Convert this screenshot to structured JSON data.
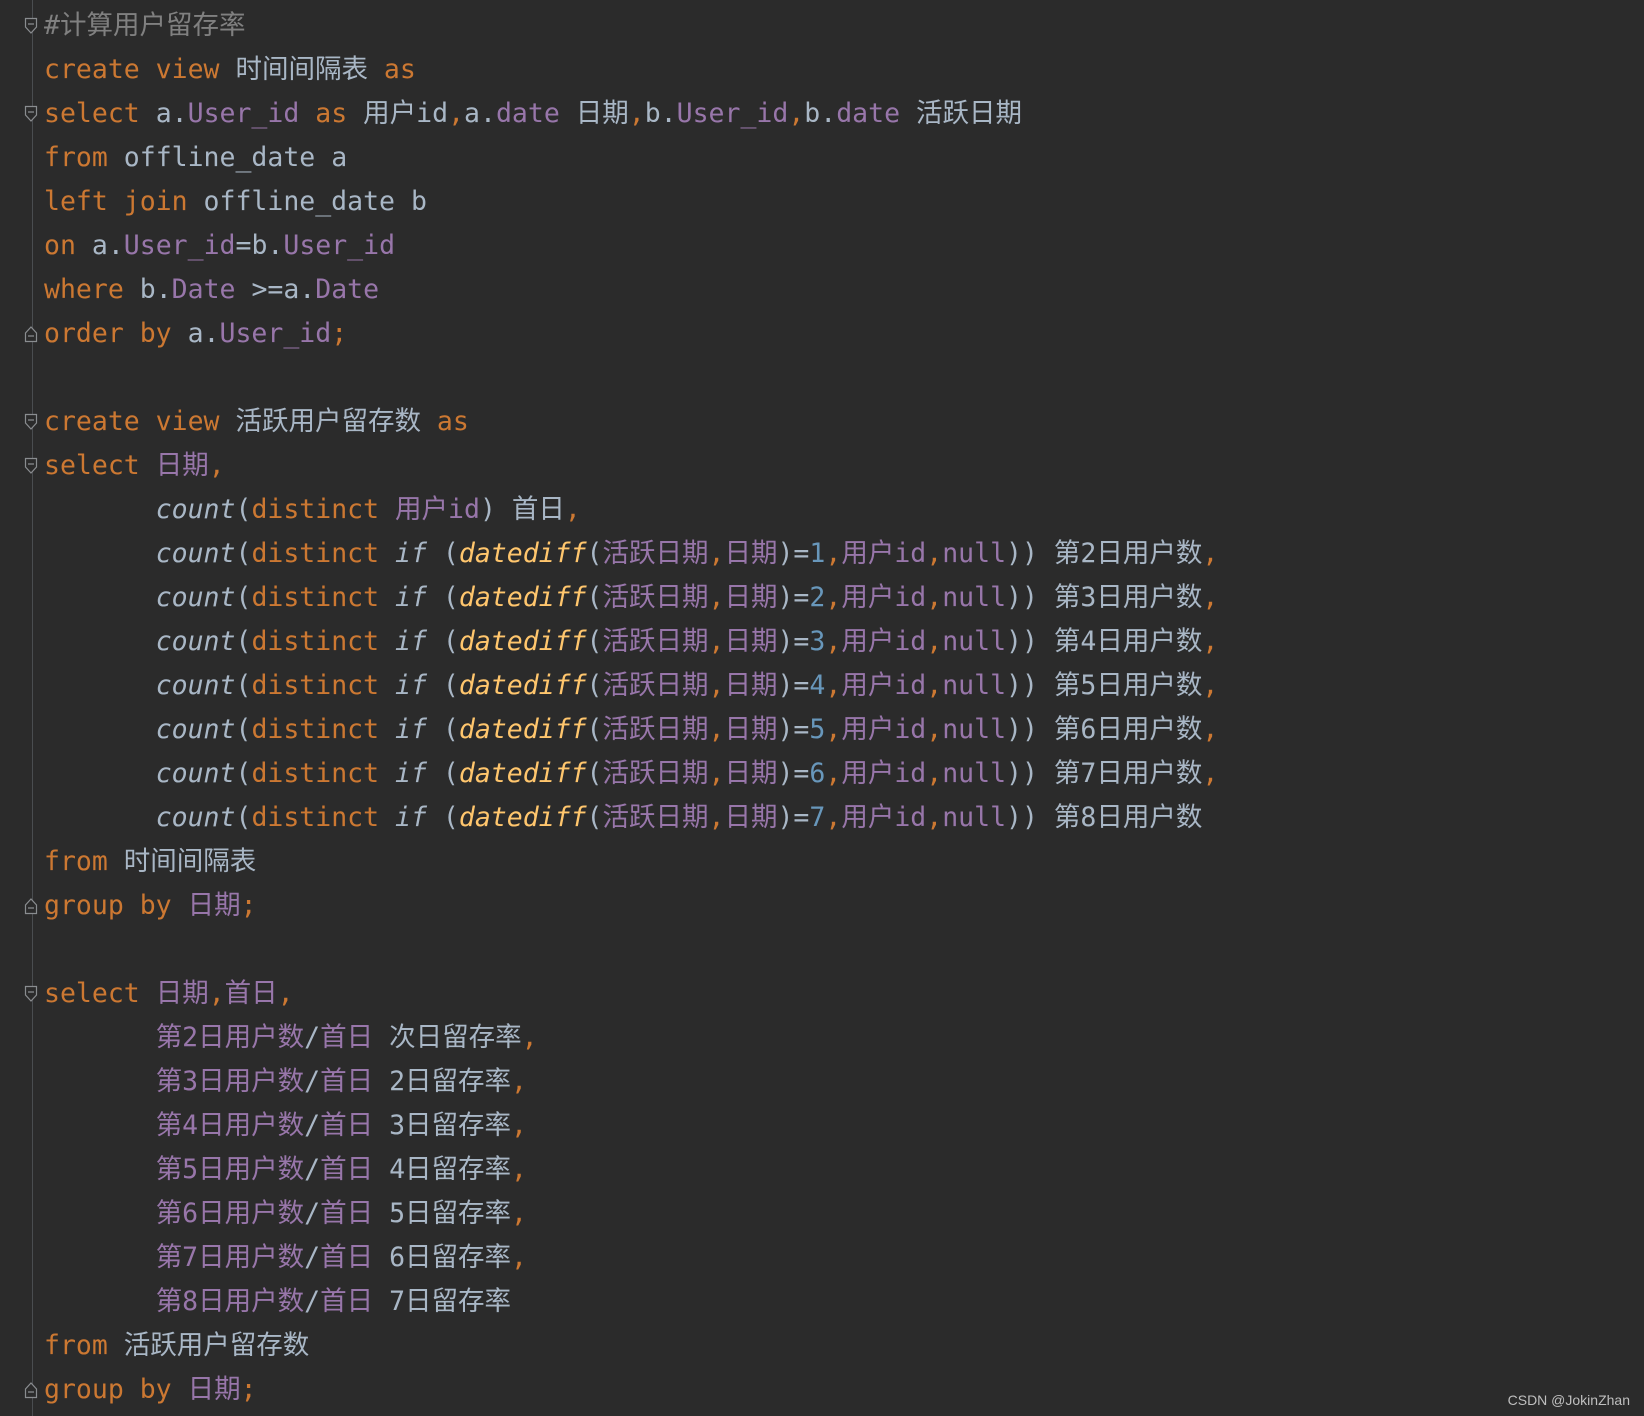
{
  "editor": {
    "lines": [
      [
        {
          "t": "#计算用户留存率",
          "c": "cm"
        }
      ],
      [
        {
          "t": "create view",
          "c": "kw"
        },
        {
          "t": " 时间间隔表 "
        },
        {
          "t": "as",
          "c": "kw"
        }
      ],
      [
        {
          "t": "select",
          "c": "kw"
        },
        {
          "t": " a."
        },
        {
          "t": "User_id",
          "c": "fld"
        },
        {
          "t": " "
        },
        {
          "t": "as",
          "c": "kw"
        },
        {
          "t": " 用户id"
        },
        {
          "t": ",",
          "c": "kw"
        },
        {
          "t": "a."
        },
        {
          "t": "date",
          "c": "fld"
        },
        {
          "t": " 日期"
        },
        {
          "t": ",",
          "c": "kw"
        },
        {
          "t": "b."
        },
        {
          "t": "User_id",
          "c": "fld"
        },
        {
          "t": ",",
          "c": "kw"
        },
        {
          "t": "b."
        },
        {
          "t": "date",
          "c": "fld"
        },
        {
          "t": " 活跃日期"
        }
      ],
      [
        {
          "t": "from",
          "c": "kw"
        },
        {
          "t": " offline_date a"
        }
      ],
      [
        {
          "t": "left join",
          "c": "kw"
        },
        {
          "t": " offline_date b"
        }
      ],
      [
        {
          "t": "on",
          "c": "kw"
        },
        {
          "t": " a."
        },
        {
          "t": "User_id",
          "c": "fld"
        },
        {
          "t": "=b."
        },
        {
          "t": "User_id",
          "c": "fld"
        }
      ],
      [
        {
          "t": "where",
          "c": "kw"
        },
        {
          "t": " b."
        },
        {
          "t": "Date",
          "c": "fld"
        },
        {
          "t": " >=a."
        },
        {
          "t": "Date",
          "c": "fld"
        }
      ],
      [
        {
          "t": "order by",
          "c": "kw"
        },
        {
          "t": " a."
        },
        {
          "t": "User_id",
          "c": "fld"
        },
        {
          "t": ";",
          "c": "kw"
        }
      ],
      [],
      [
        {
          "t": "create view",
          "c": "kw"
        },
        {
          "t": " 活跃用户留存数 "
        },
        {
          "t": "as",
          "c": "kw"
        }
      ],
      [
        {
          "t": "select",
          "c": "kw"
        },
        {
          "t": " "
        },
        {
          "t": "日期",
          "c": "fld"
        },
        {
          "t": ",",
          "c": "kw"
        }
      ],
      [
        {
          "t": "       "
        },
        {
          "t": "count",
          "c": "it"
        },
        {
          "t": "("
        },
        {
          "t": "distinct",
          "c": "kw"
        },
        {
          "t": " "
        },
        {
          "t": "用户id",
          "c": "fld"
        },
        {
          "t": ") 首日"
        },
        {
          "t": ",",
          "c": "kw"
        }
      ],
      [
        {
          "t": "       "
        },
        {
          "t": "count",
          "c": "it"
        },
        {
          "t": "("
        },
        {
          "t": "distinct",
          "c": "kw"
        },
        {
          "t": " "
        },
        {
          "t": "if",
          "c": "it"
        },
        {
          "t": " ("
        },
        {
          "t": "datediff",
          "c": "fn"
        },
        {
          "t": "("
        },
        {
          "t": "活跃日期",
          "c": "fld"
        },
        {
          "t": ",",
          "c": "kw"
        },
        {
          "t": "日期",
          "c": "fld"
        },
        {
          "t": ")="
        },
        {
          "t": "1",
          "c": "num"
        },
        {
          "t": ",",
          "c": "kw"
        },
        {
          "t": "用户id",
          "c": "fld"
        },
        {
          "t": ",",
          "c": "kw"
        },
        {
          "t": "null",
          "c": "fld"
        },
        {
          "t": ")) 第2日用户数"
        },
        {
          "t": ",",
          "c": "kw"
        }
      ],
      [
        {
          "t": "       "
        },
        {
          "t": "count",
          "c": "it"
        },
        {
          "t": "("
        },
        {
          "t": "distinct",
          "c": "kw"
        },
        {
          "t": " "
        },
        {
          "t": "if",
          "c": "it"
        },
        {
          "t": " ("
        },
        {
          "t": "datediff",
          "c": "fn"
        },
        {
          "t": "("
        },
        {
          "t": "活跃日期",
          "c": "fld"
        },
        {
          "t": ",",
          "c": "kw"
        },
        {
          "t": "日期",
          "c": "fld"
        },
        {
          "t": ")="
        },
        {
          "t": "2",
          "c": "num"
        },
        {
          "t": ",",
          "c": "kw"
        },
        {
          "t": "用户id",
          "c": "fld"
        },
        {
          "t": ",",
          "c": "kw"
        },
        {
          "t": "null",
          "c": "fld"
        },
        {
          "t": ")) 第3日用户数"
        },
        {
          "t": ",",
          "c": "kw"
        }
      ],
      [
        {
          "t": "       "
        },
        {
          "t": "count",
          "c": "it"
        },
        {
          "t": "("
        },
        {
          "t": "distinct",
          "c": "kw"
        },
        {
          "t": " "
        },
        {
          "t": "if",
          "c": "it"
        },
        {
          "t": " ("
        },
        {
          "t": "datediff",
          "c": "fn"
        },
        {
          "t": "("
        },
        {
          "t": "活跃日期",
          "c": "fld"
        },
        {
          "t": ",",
          "c": "kw"
        },
        {
          "t": "日期",
          "c": "fld"
        },
        {
          "t": ")="
        },
        {
          "t": "3",
          "c": "num"
        },
        {
          "t": ",",
          "c": "kw"
        },
        {
          "t": "用户id",
          "c": "fld"
        },
        {
          "t": ",",
          "c": "kw"
        },
        {
          "t": "null",
          "c": "fld"
        },
        {
          "t": ")) 第4日用户数"
        },
        {
          "t": ",",
          "c": "kw"
        }
      ],
      [
        {
          "t": "       "
        },
        {
          "t": "count",
          "c": "it"
        },
        {
          "t": "("
        },
        {
          "t": "distinct",
          "c": "kw"
        },
        {
          "t": " "
        },
        {
          "t": "if",
          "c": "it"
        },
        {
          "t": " ("
        },
        {
          "t": "datediff",
          "c": "fn"
        },
        {
          "t": "("
        },
        {
          "t": "活跃日期",
          "c": "fld"
        },
        {
          "t": ",",
          "c": "kw"
        },
        {
          "t": "日期",
          "c": "fld"
        },
        {
          "t": ")="
        },
        {
          "t": "4",
          "c": "num"
        },
        {
          "t": ",",
          "c": "kw"
        },
        {
          "t": "用户id",
          "c": "fld"
        },
        {
          "t": ",",
          "c": "kw"
        },
        {
          "t": "null",
          "c": "fld"
        },
        {
          "t": ")) 第5日用户数"
        },
        {
          "t": ",",
          "c": "kw"
        }
      ],
      [
        {
          "t": "       "
        },
        {
          "t": "count",
          "c": "it"
        },
        {
          "t": "("
        },
        {
          "t": "distinct",
          "c": "kw"
        },
        {
          "t": " "
        },
        {
          "t": "if",
          "c": "it"
        },
        {
          "t": " ("
        },
        {
          "t": "datediff",
          "c": "fn"
        },
        {
          "t": "("
        },
        {
          "t": "活跃日期",
          "c": "fld"
        },
        {
          "t": ",",
          "c": "kw"
        },
        {
          "t": "日期",
          "c": "fld"
        },
        {
          "t": ")="
        },
        {
          "t": "5",
          "c": "num"
        },
        {
          "t": ",",
          "c": "kw"
        },
        {
          "t": "用户id",
          "c": "fld"
        },
        {
          "t": ",",
          "c": "kw"
        },
        {
          "t": "null",
          "c": "fld"
        },
        {
          "t": ")) 第6日用户数"
        },
        {
          "t": ",",
          "c": "kw"
        }
      ],
      [
        {
          "t": "       "
        },
        {
          "t": "count",
          "c": "it"
        },
        {
          "t": "("
        },
        {
          "t": "distinct",
          "c": "kw"
        },
        {
          "t": " "
        },
        {
          "t": "if",
          "c": "it"
        },
        {
          "t": " ("
        },
        {
          "t": "datediff",
          "c": "fn"
        },
        {
          "t": "("
        },
        {
          "t": "活跃日期",
          "c": "fld"
        },
        {
          "t": ",",
          "c": "kw"
        },
        {
          "t": "日期",
          "c": "fld"
        },
        {
          "t": ")="
        },
        {
          "t": "6",
          "c": "num"
        },
        {
          "t": ",",
          "c": "kw"
        },
        {
          "t": "用户id",
          "c": "fld"
        },
        {
          "t": ",",
          "c": "kw"
        },
        {
          "t": "null",
          "c": "fld"
        },
        {
          "t": ")) 第7日用户数"
        },
        {
          "t": ",",
          "c": "kw"
        }
      ],
      [
        {
          "t": "       "
        },
        {
          "t": "count",
          "c": "it"
        },
        {
          "t": "("
        },
        {
          "t": "distinct",
          "c": "kw"
        },
        {
          "t": " "
        },
        {
          "t": "if",
          "c": "it"
        },
        {
          "t": " ("
        },
        {
          "t": "datediff",
          "c": "fn"
        },
        {
          "t": "("
        },
        {
          "t": "活跃日期",
          "c": "fld"
        },
        {
          "t": ",",
          "c": "kw"
        },
        {
          "t": "日期",
          "c": "fld"
        },
        {
          "t": ")="
        },
        {
          "t": "7",
          "c": "num"
        },
        {
          "t": ",",
          "c": "kw"
        },
        {
          "t": "用户id",
          "c": "fld"
        },
        {
          "t": ",",
          "c": "kw"
        },
        {
          "t": "null",
          "c": "fld"
        },
        {
          "t": ")) 第8日用户数"
        }
      ],
      [
        {
          "t": "from",
          "c": "kw"
        },
        {
          "t": " 时间间隔表"
        }
      ],
      [
        {
          "t": "group by",
          "c": "kw"
        },
        {
          "t": " "
        },
        {
          "t": "日期",
          "c": "fld"
        },
        {
          "t": ";",
          "c": "kw"
        }
      ],
      [],
      [
        {
          "t": "select",
          "c": "kw"
        },
        {
          "t": " "
        },
        {
          "t": "日期",
          "c": "fld"
        },
        {
          "t": ",",
          "c": "kw"
        },
        {
          "t": "首日",
          "c": "fld"
        },
        {
          "t": ",",
          "c": "kw"
        }
      ],
      [
        {
          "t": "       "
        },
        {
          "t": "第2日用户数",
          "c": "fld"
        },
        {
          "t": "/"
        },
        {
          "t": "首日",
          "c": "fld"
        },
        {
          "t": " 次日留存率"
        },
        {
          "t": ",",
          "c": "kw"
        }
      ],
      [
        {
          "t": "       "
        },
        {
          "t": "第3日用户数",
          "c": "fld"
        },
        {
          "t": "/"
        },
        {
          "t": "首日",
          "c": "fld"
        },
        {
          "t": " 2日留存率"
        },
        {
          "t": ",",
          "c": "kw"
        }
      ],
      [
        {
          "t": "       "
        },
        {
          "t": "第4日用户数",
          "c": "fld"
        },
        {
          "t": "/"
        },
        {
          "t": "首日",
          "c": "fld"
        },
        {
          "t": " 3日留存率"
        },
        {
          "t": ",",
          "c": "kw"
        }
      ],
      [
        {
          "t": "       "
        },
        {
          "t": "第5日用户数",
          "c": "fld"
        },
        {
          "t": "/"
        },
        {
          "t": "首日",
          "c": "fld"
        },
        {
          "t": " 4日留存率"
        },
        {
          "t": ",",
          "c": "kw"
        }
      ],
      [
        {
          "t": "       "
        },
        {
          "t": "第6日用户数",
          "c": "fld"
        },
        {
          "t": "/"
        },
        {
          "t": "首日",
          "c": "fld"
        },
        {
          "t": " 5日留存率"
        },
        {
          "t": ",",
          "c": "kw"
        }
      ],
      [
        {
          "t": "       "
        },
        {
          "t": "第7日用户数",
          "c": "fld"
        },
        {
          "t": "/"
        },
        {
          "t": "首日",
          "c": "fld"
        },
        {
          "t": " 6日留存率"
        },
        {
          "t": ",",
          "c": "kw"
        }
      ],
      [
        {
          "t": "       "
        },
        {
          "t": "第8日用户数",
          "c": "fld"
        },
        {
          "t": "/"
        },
        {
          "t": "首日",
          "c": "fld"
        },
        {
          "t": " 7日留存率"
        }
      ],
      [
        {
          "t": "from",
          "c": "kw"
        },
        {
          "t": " 活跃用户留存数"
        }
      ],
      [
        {
          "t": "group by",
          "c": "kw"
        },
        {
          "t": " "
        },
        {
          "t": "日期",
          "c": "fld"
        },
        {
          "t": ";",
          "c": "kw"
        }
      ]
    ],
    "fold_markers": [
      {
        "line": 0,
        "icon": "fold-open-icon"
      },
      {
        "line": 2,
        "icon": "fold-open-icon"
      },
      {
        "line": 7,
        "icon": "fold-close-icon"
      },
      {
        "line": 9,
        "icon": "fold-open-icon"
      },
      {
        "line": 10,
        "icon": "fold-open-icon"
      },
      {
        "line": 20,
        "icon": "fold-close-icon"
      },
      {
        "line": 22,
        "icon": "fold-open-icon"
      },
      {
        "line": 31,
        "icon": "fold-close-icon"
      }
    ]
  },
  "theme": {
    "background": "#2b2b2b",
    "default_text": "#a9b7c6",
    "keyword": "#cc7832",
    "field": "#9876aa",
    "function": "#ffc66d",
    "number": "#6897bb",
    "comment": "#808080"
  },
  "watermark": "CSDN @JokinZhan"
}
